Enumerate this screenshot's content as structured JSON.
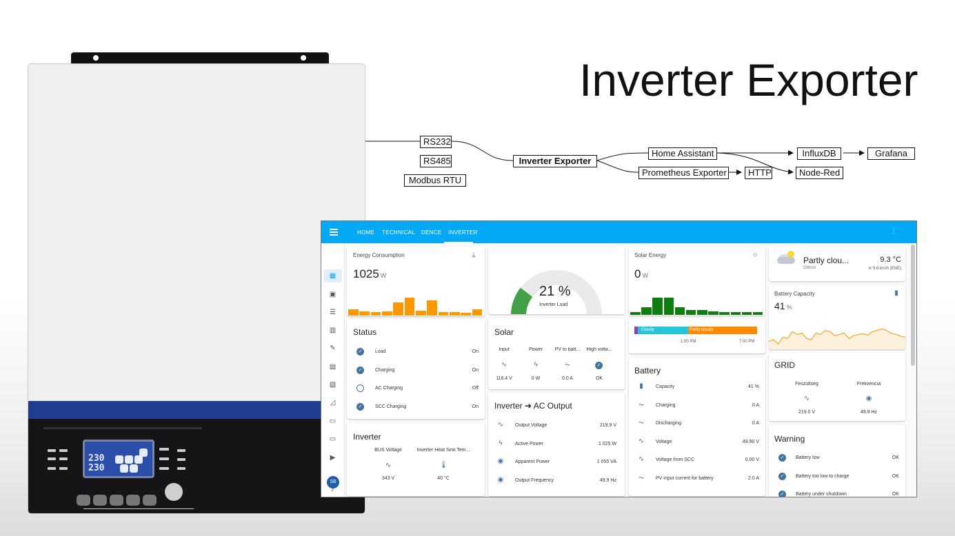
{
  "title": "Inverter Exporter",
  "colors": {
    "topbar": "#03a9f4",
    "accent_icon": "#44739e",
    "energy_bar": "#ff9800",
    "solar_bar": "#0f7d0f",
    "cloudy": "#26c6da",
    "partly_cloudy": "#ff8a00",
    "battery_line": "#f5a623"
  },
  "device": {
    "lcd_line1": "230",
    "lcd_line2": "230"
  },
  "flow": {
    "inputs": [
      "RS232",
      "RS485",
      "Modbus RTU"
    ],
    "core": "Inverter Exporter",
    "targets": [
      "Home Assistant",
      "Prometheus Exporter",
      "HTTP",
      "InfluxDB",
      "Node-Red",
      "Grafana"
    ]
  },
  "dashboard": {
    "tabs": [
      "HOME",
      "TECHNICAL",
      "DENCE",
      "INVERTER"
    ],
    "user_initials": "SB",
    "energy": {
      "title": "Energy Consumption",
      "value": "1025",
      "unit": "W",
      "bars": [
        0.22,
        0.15,
        0.12,
        0.15,
        0.45,
        0.62,
        0.17,
        0.52,
        0.13,
        0.13,
        0.1,
        0.22
      ]
    },
    "gauge": {
      "value": "21 %",
      "label": "Inverter Load",
      "fraction": 0.21
    },
    "solar_energy": {
      "title": "Solar Energy",
      "value": "0",
      "unit": "W",
      "bars": [
        0.1,
        0.28,
        0.62,
        0.62,
        0.28,
        0.18,
        0.16,
        0.12,
        0.1,
        0.1,
        0.1,
        0.1
      ]
    },
    "forecast": {
      "seg1": "Cloudy",
      "seg2": "Partly cloudy",
      "time1": "1:00 PM",
      "time2": "7:00 PM"
    },
    "weather": {
      "condition": "Partly clou...",
      "temp": "9.3 °C",
      "location": "Otthon",
      "wind": "5.6 km/h (ENE)"
    },
    "battery_capacity": {
      "title": "Battery Capacity",
      "value": "41",
      "unit": "%",
      "series": [
        0.2,
        0.25,
        0.1,
        0.35,
        0.3,
        0.55,
        0.45,
        0.5,
        0.3,
        0.25,
        0.5,
        0.45,
        0.6,
        0.55,
        0.4,
        0.45,
        0.5,
        0.3,
        0.4,
        0.45,
        0.48,
        0.42,
        0.55,
        0.6,
        0.65,
        0.6,
        0.5,
        0.45,
        0.38,
        0.35
      ]
    },
    "status": {
      "title": "Status",
      "rows": [
        {
          "label": "Load",
          "value": "On",
          "on": true
        },
        {
          "label": "Charging",
          "value": "On",
          "on": true
        },
        {
          "label": "AC Charging",
          "value": "Off",
          "on": false
        },
        {
          "label": "SCC Charging",
          "value": "On",
          "on": true
        }
      ]
    },
    "solar": {
      "title": "Solar",
      "cols": [
        {
          "head": "Input",
          "val": "116.4 V",
          "icon": "sine-wave-icon"
        },
        {
          "head": "Power",
          "val": "0 W",
          "icon": "lightning-icon"
        },
        {
          "head": "PV to batt...",
          "val": "0.0 A",
          "icon": "current-icon"
        },
        {
          "head": "High volta...",
          "val": "OK",
          "icon": "check-icon"
        }
      ]
    },
    "battery": {
      "title": "Battery",
      "rows": [
        {
          "label": "Capacity",
          "value": "41 %",
          "icon": "battery-icon"
        },
        {
          "label": "Charging",
          "value": "0 A",
          "icon": "current-icon"
        },
        {
          "label": "Discharging",
          "value": "0 A",
          "icon": "current-icon"
        },
        {
          "label": "Voltage",
          "value": "49.90 V",
          "icon": "sine-wave-icon"
        },
        {
          "label": "Voltage from SCC",
          "value": "0.00 V",
          "icon": "sine-wave-icon"
        },
        {
          "label": "PV input current for battery",
          "value": "2.0 A",
          "icon": "current-icon"
        }
      ]
    },
    "grid": {
      "title": "GRID",
      "cols": [
        {
          "head": "Feszültség",
          "val": "219.0 V",
          "icon": "sine-wave-icon"
        },
        {
          "head": "Frekvencia",
          "val": "49.9 Hz",
          "icon": "eye-icon"
        }
      ]
    },
    "inverter": {
      "title": "Inverter",
      "cols": [
        {
          "head": "BUS Voltage",
          "val": "343 V",
          "icon": "sine-wave-icon"
        },
        {
          "head": "Inverter Heat Sink Tem...",
          "val": "40 °C",
          "icon": "thermometer-icon"
        }
      ]
    },
    "ac_output": {
      "title": "Inverter ➔ AC Output",
      "rows": [
        {
          "label": "Output Voltage",
          "value": "219.9 V",
          "icon": "sine-wave-icon"
        },
        {
          "label": "Active Power",
          "value": "1 025 W",
          "icon": "lightning-icon"
        },
        {
          "label": "Apparent Power",
          "value": "1 055 VA",
          "icon": "eye-icon"
        },
        {
          "label": "Output Frequency",
          "value": "49.9 Hz",
          "icon": "eye-icon"
        }
      ]
    },
    "warning": {
      "title": "Warning",
      "rows": [
        {
          "label": "Battery low",
          "value": "OK"
        },
        {
          "label": "Battery too low to charge",
          "value": "OK"
        },
        {
          "label": "Battery under shutdown",
          "value": "OK"
        }
      ]
    }
  }
}
